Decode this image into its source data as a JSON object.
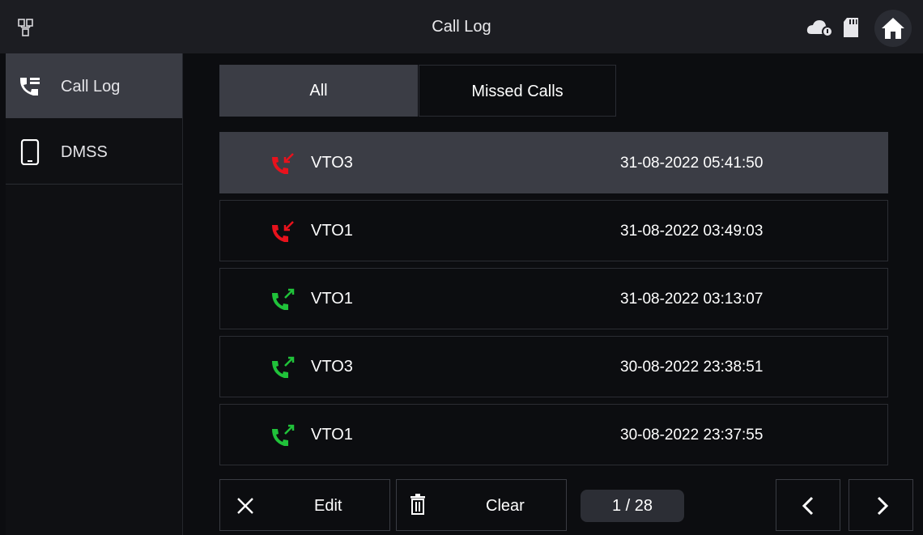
{
  "header": {
    "title": "Call Log",
    "icons": [
      "network-icon",
      "cloud-icon",
      "sd-card-icon",
      "home-icon"
    ]
  },
  "sidebar": {
    "items": [
      {
        "label": "Call Log",
        "icon": "phone-book-icon",
        "active": true
      },
      {
        "label": "DMSS",
        "icon": "mobile-device-icon",
        "active": false
      }
    ]
  },
  "tabs": [
    {
      "label": "All",
      "active": true
    },
    {
      "label": "Missed Calls",
      "active": false
    }
  ],
  "calls": [
    {
      "name": "VTO3",
      "time": "31-08-2022 05:41:50",
      "type": "missed",
      "selected": true
    },
    {
      "name": "VTO1",
      "time": "31-08-2022 03:49:03",
      "type": "missed",
      "selected": false
    },
    {
      "name": "VTO1",
      "time": "31-08-2022 03:13:07",
      "type": "outgoing",
      "selected": false
    },
    {
      "name": "VTO3",
      "time": "30-08-2022 23:38:51",
      "type": "outgoing",
      "selected": false
    },
    {
      "name": "VTO1",
      "time": "30-08-2022 23:37:55",
      "type": "outgoing",
      "selected": false
    }
  ],
  "footer": {
    "edit_label": "Edit",
    "clear_label": "Clear",
    "page": "1 / 28"
  },
  "colors": {
    "missed": "#e8121c",
    "outgoing": "#20c23a",
    "accent_bg": "#3b3d45"
  }
}
